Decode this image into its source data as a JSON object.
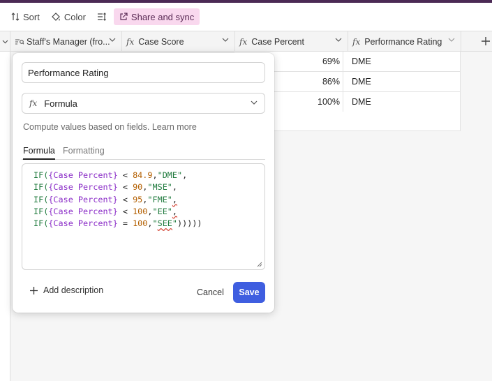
{
  "toolbar": {
    "sort_label": "Sort",
    "color_label": "Color",
    "share_label": "Share and sync"
  },
  "columns": [
    {
      "label": "Staff's Manager (fro...",
      "icon": "lookup-icon"
    },
    {
      "label": "Case Score",
      "icon": "formula-icon"
    },
    {
      "label": "Case Percent",
      "icon": "formula-icon"
    },
    {
      "label": "Performance Rating",
      "icon": "formula-icon"
    }
  ],
  "rows": [
    {
      "case_percent": "69%",
      "performance_rating": "DME"
    },
    {
      "case_percent": "86%",
      "performance_rating": "DME"
    },
    {
      "case_percent": "100%",
      "performance_rating": "DME"
    }
  ],
  "dialog": {
    "field_name": "Performance Rating",
    "field_type": "Formula",
    "fx_symbol": "fx",
    "hint": "Compute values based on fields.",
    "learn_more": "Learn more",
    "tabs": [
      "Formula",
      "Formatting"
    ],
    "formula_lines": [
      "IF({Case Percent} < 84.9,\"DME\",",
      "IF({Case Percent} < 90,\"MSE\",",
      "IF({Case Percent} < 95,\"FME\",",
      "IF({Case Percent} < 100,\"EE\",",
      "IF({Case Percent} = 100,\"SEE\")))))"
    ],
    "add_description": "Add description",
    "cancel": "Cancel",
    "save": "Save"
  },
  "colors": {
    "accent": "#3f5ee0",
    "share_bg": "#f9d8ee",
    "topbar": "#4b2a55"
  }
}
